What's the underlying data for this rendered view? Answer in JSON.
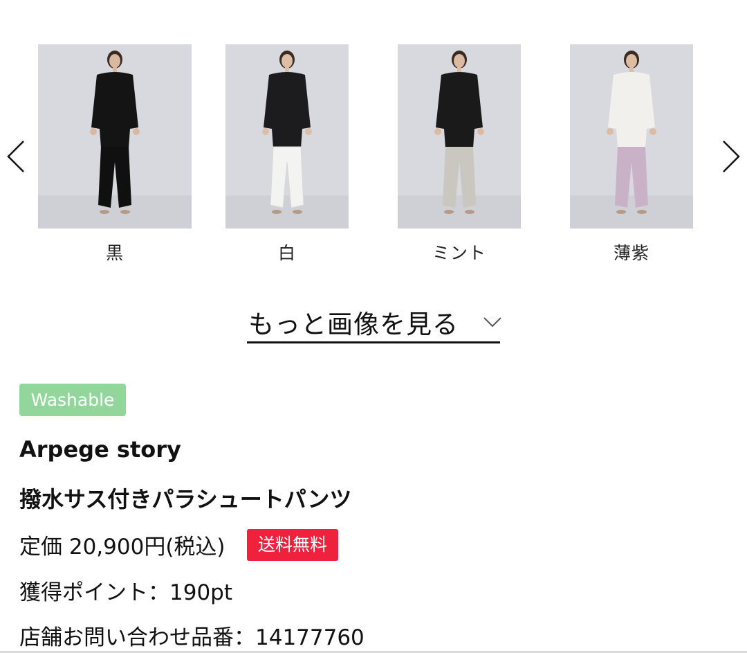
{
  "carousel": {
    "items": [
      {
        "label": "黒",
        "top_color": "#141414",
        "bottom_color": "#101010",
        "skin": "#d9b8a0"
      },
      {
        "label": "白",
        "top_color": "#1c1c1e",
        "bottom_color": "#f3f3f1",
        "skin": "#dcbda5"
      },
      {
        "label": "ミント",
        "top_color": "#1a1a1a",
        "bottom_color": "#c9c7bf",
        "skin": "#dbbaa1"
      },
      {
        "label": "薄紫",
        "top_color": "#f2f0ec",
        "bottom_color": "#c9b2c7",
        "skin": "#dcbca3"
      }
    ],
    "prev_icon": "chevron-left-icon",
    "next_icon": "chevron-right-icon"
  },
  "more_images": {
    "label": "もっと画像を見る",
    "icon": "chevron-down-icon"
  },
  "product": {
    "badge": "Washable",
    "badge_color": "#92d69b",
    "brand": "Arpege story",
    "name": "撥水サス付きパラシュートパンツ",
    "price": "定価 20,900円(税込)",
    "shipping_badge": "送料無料",
    "shipping_badge_color": "#f0213d",
    "points": "獲得ポイント：190pt",
    "store_number": "店舗お問い合わせ品番：14177760"
  }
}
